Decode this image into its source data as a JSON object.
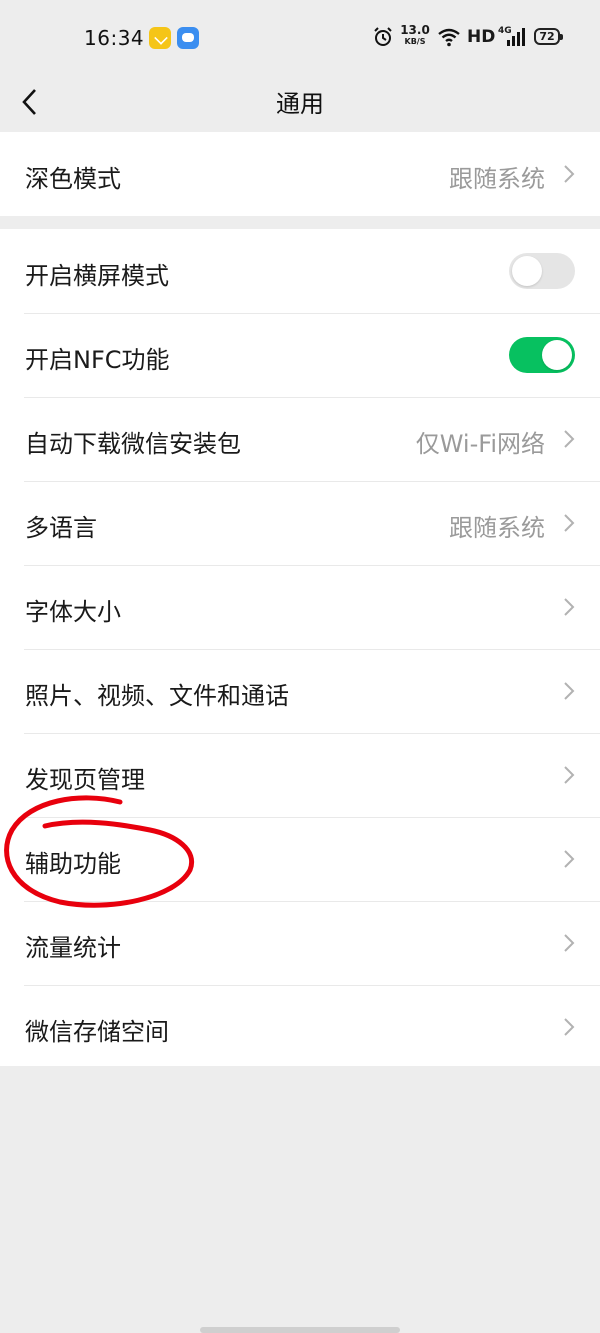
{
  "status_bar": {
    "time": "16:34",
    "net_speed_value": "13.0",
    "net_speed_unit": "KB/S",
    "network_label": "HD",
    "lte_label": "4G",
    "battery_level": "72"
  },
  "nav": {
    "title": "通用"
  },
  "group1": {
    "dark_mode": {
      "label": "深色模式",
      "value": "跟随系统"
    }
  },
  "group2": {
    "landscape": {
      "label": "开启横屏模式",
      "enabled": false
    },
    "nfc": {
      "label": "开启NFC功能",
      "enabled": true
    },
    "auto_download": {
      "label": "自动下载微信安装包",
      "value": "仅Wi-Fi网络"
    },
    "language": {
      "label": "多语言",
      "value": "跟随系统"
    },
    "font_size": {
      "label": "字体大小"
    },
    "media": {
      "label": "照片、视频、文件和通话"
    },
    "discover": {
      "label": "发现页管理"
    },
    "accessibility": {
      "label": "辅助功能"
    },
    "data_usage": {
      "label": "流量统计"
    },
    "storage": {
      "label": "微信存储空间"
    }
  },
  "colors": {
    "toggle_on": "#07c160",
    "toggle_off": "#e5e5e5",
    "annotation": "#e8000d",
    "background": "#ededed"
  }
}
